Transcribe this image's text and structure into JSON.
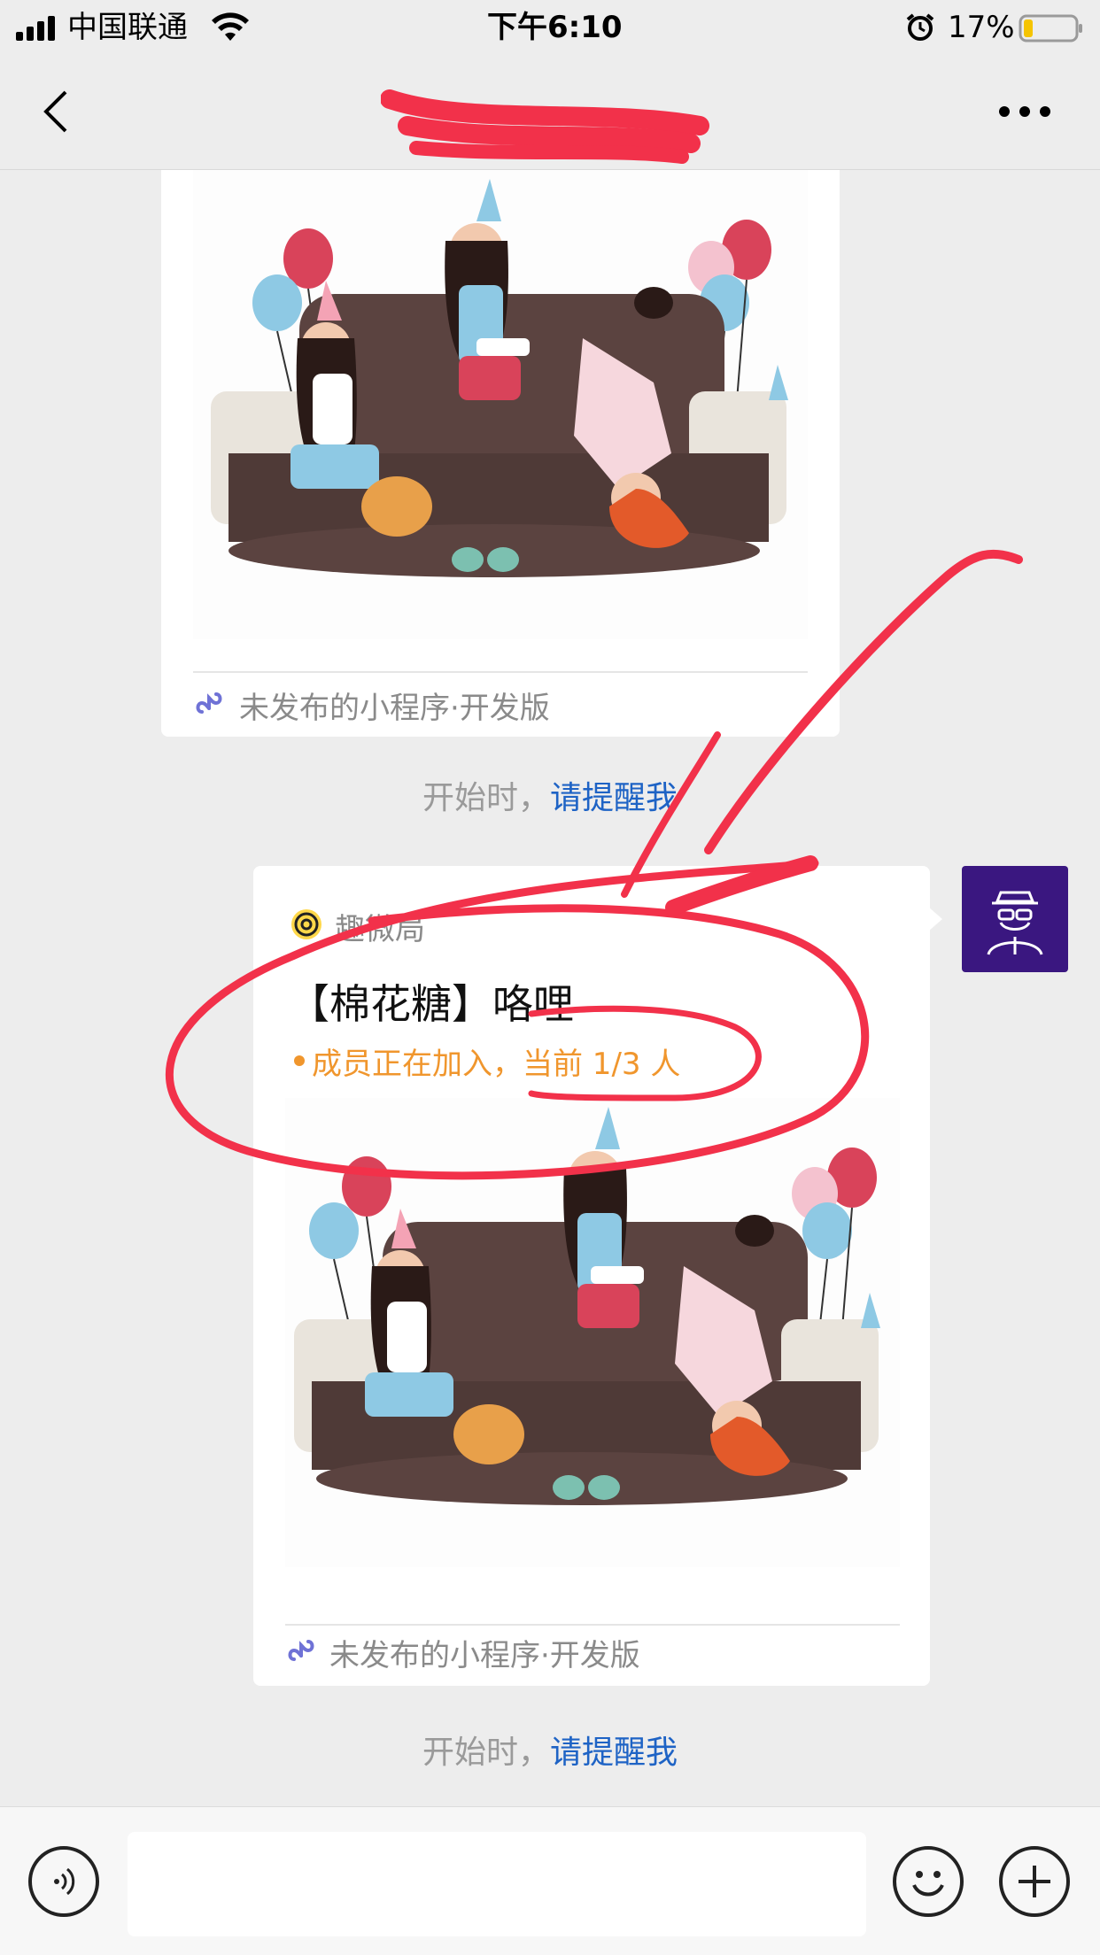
{
  "status_bar": {
    "carrier": "中国联通",
    "time": "下午6:10",
    "battery_percent": "17%",
    "battery_level": 0.17
  },
  "nav": {
    "title": "",
    "more_icon": "more-dots-icon",
    "back_icon": "chevron-left-icon"
  },
  "messages": [
    {
      "footer": "未发布的小程序·开发版",
      "reminder_prefix": "开始时，",
      "reminder_link": "请提醒我"
    },
    {
      "source": "趣微局",
      "title": "【棉花糖】咯哩",
      "status": "成员正在加入，当前 1/3 人",
      "footer": "未发布的小程序·开发版",
      "reminder_prefix": "开始时，",
      "reminder_link": "请提醒我"
    }
  ],
  "input_bar": {
    "voice_icon": "voice-icon",
    "emoji_icon": "emoji-icon",
    "plus_icon": "plus-icon"
  },
  "colors": {
    "background": "#ededed",
    "link": "#1e63c5",
    "status_orange": "#f0962d",
    "annotation_red": "#f2314a",
    "avatar_bg": "#3a1780"
  }
}
